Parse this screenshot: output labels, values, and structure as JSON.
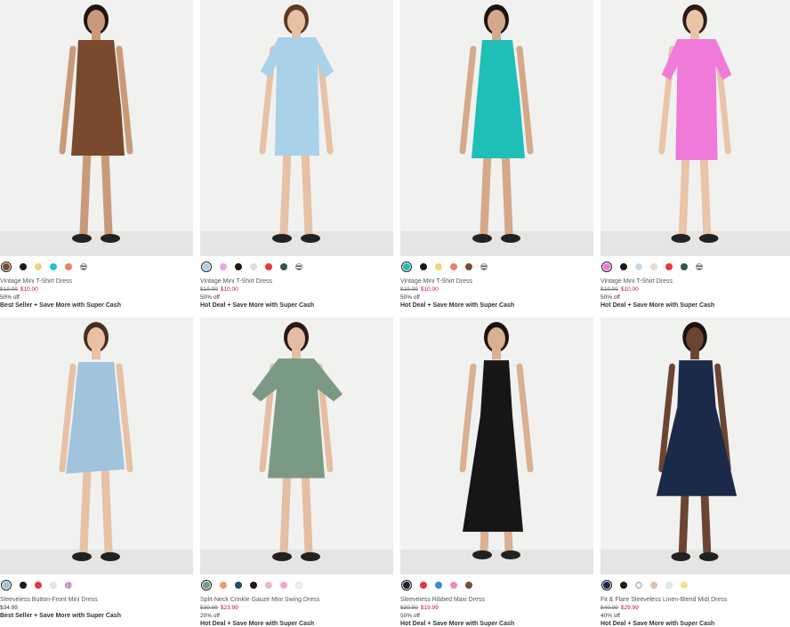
{
  "products": [
    {
      "name": "Vintage Mini T-Shirt Dress",
      "price_old": "$19.99",
      "price_new": "$10.00",
      "price_regular": "",
      "discount": "50% off",
      "promo": "Best Seller + Save More with Super Cash",
      "dress_color": "#7a4a2e",
      "swatches": [
        "#7a4a2e",
        "#1a1a1a",
        "#f3d27a",
        "#29c3c3",
        "#ef7f6c",
        "stripe"
      ],
      "selected": 0,
      "icon": "product-photo-brown-tshirt-dress"
    },
    {
      "name": "Vintage Mini T-Shirt Dress",
      "price_old": "$19.99",
      "price_new": "$10.00",
      "price_regular": "",
      "discount": "50% off",
      "promo": "Hot Deal + Save More with Super Cash",
      "dress_color": "#a9d2e8",
      "swatches": [
        "#a9d2e8",
        "#e9a6de",
        "#1a1a1a",
        "#eadbcc",
        "#e23a3f",
        "#2d5a44",
        "stripe"
      ],
      "selected": 0,
      "icon": "product-photo-lightblue-tshirt-dress"
    },
    {
      "name": "Vintage Mini T-Shirt Dress",
      "price_old": "$19.99",
      "price_new": "$10.00",
      "price_regular": "",
      "discount": "50% off",
      "promo": "Hot Deal + Save More with Super Cash",
      "dress_color": "#1fbfb8",
      "swatches": [
        "#1fbfb8",
        "#1a1a1a",
        "#f3d27a",
        "#ef7f6c",
        "#7a4a2e",
        "stripe"
      ],
      "selected": 0,
      "icon": "product-photo-teal-tank-dress"
    },
    {
      "name": "Vintage Mini T-Shirt Dress",
      "price_old": "$19.99",
      "price_new": "$10.00",
      "price_regular": "",
      "discount": "50% off",
      "promo": "Hot Deal + Save More with Super Cash",
      "dress_color": "#f07ad8",
      "swatches": [
        "#f07ad8",
        "#1a1a1a",
        "#b9dbea",
        "#eadbcc",
        "#e23a3f",
        "#2d5a44",
        "stripe"
      ],
      "selected": 0,
      "icon": "product-photo-pink-tshirt-dress"
    },
    {
      "name": "Sleeveless Button-Front Mini Dress",
      "price_old": "",
      "price_new": "",
      "price_regular": "$34.99",
      "discount": "",
      "promo": "Best Seller + Save More with Super Cash",
      "dress_color": "#9fc4dc",
      "swatches": [
        "#9fc4dc",
        "#1a1a1a",
        "#e23a3f",
        "#f1e4da",
        "pinkstripe"
      ],
      "selected": 0,
      "icon": "product-photo-chambray-button-dress"
    },
    {
      "name": "Split-Neck Crinkle Gauze Mini Swing Dress",
      "price_old": "$39.99",
      "price_new": "$23.99",
      "price_regular": "",
      "discount": "20% off",
      "promo": "Hot Deal + Save More with Super Cash",
      "dress_color": "#7b9a84",
      "swatches": [
        "#7b9a84",
        "#f29a6a",
        "#1f4f5f",
        "#1a1a1a",
        "#e5b9c8",
        "#f4a8c8",
        "#f3f0ee"
      ],
      "selected": 0,
      "icon": "product-photo-green-swing-dress"
    },
    {
      "name": "Sleeveless Ribbed Maxi Dress",
      "price_old": "$39.99",
      "price_new": "$19.99",
      "price_regular": "",
      "discount": "50% off",
      "promo": "Hot Deal + Save More with Super Cash",
      "dress_color": "#161616",
      "swatches": [
        "#1a2233",
        "#e23a3f",
        "#3b8ad0",
        "#e98ac3",
        "#7a4a3e"
      ],
      "selected": 0,
      "icon": "product-photo-black-maxi-dress"
    },
    {
      "name": "Fit & Flare Sleeveless Linen-Blend Midi Dress",
      "price_old": "$49.99",
      "price_new": "$29.99",
      "price_regular": "",
      "discount": "40% off",
      "promo": "Hot Deal + Save More with Super Cash",
      "dress_color": "#1c2a4a",
      "swatches": [
        "#1c2a4a",
        "#1a1a1a",
        "floral",
        "#d6c3b4",
        "#d9ecf3",
        "#f6e08a"
      ],
      "selected": 0,
      "icon": "product-photo-navy-floral-midi-dress"
    }
  ]
}
